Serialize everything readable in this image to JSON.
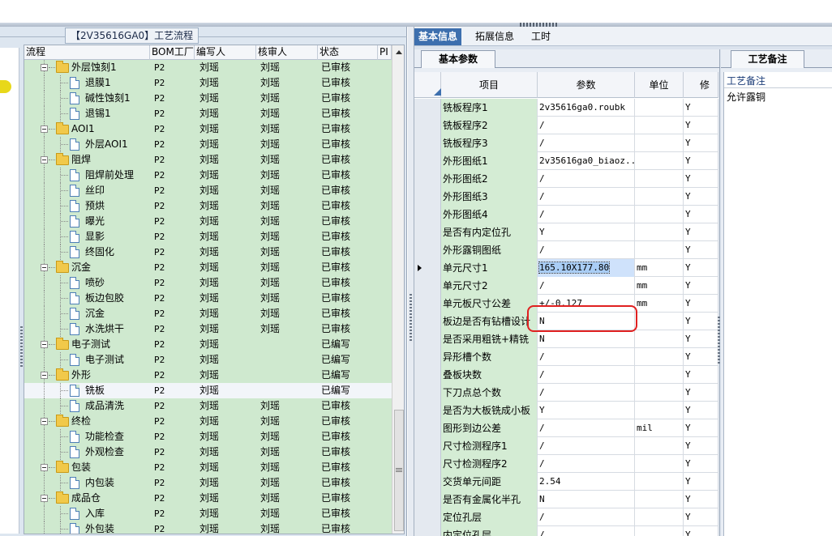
{
  "left_panel": {
    "legend": "【2V35616GA0】工艺流程",
    "columns": [
      "流程",
      "BOM工厂",
      "编写人",
      "核审人",
      "状态",
      "PI"
    ],
    "rows": [
      {
        "level": 1,
        "type": "folder",
        "name": "外层蚀刻1",
        "bom": "P2",
        "writer": "刘瑶",
        "reviewer": "刘瑶",
        "status": "已审核"
      },
      {
        "level": 2,
        "type": "doc",
        "name": "退膜1",
        "bom": "P2",
        "writer": "刘瑶",
        "reviewer": "刘瑶",
        "status": "已审核"
      },
      {
        "level": 2,
        "type": "doc",
        "name": "碱性蚀刻1",
        "bom": "P2",
        "writer": "刘瑶",
        "reviewer": "刘瑶",
        "status": "已审核"
      },
      {
        "level": 2,
        "type": "doc",
        "name": "退锡1",
        "bom": "P2",
        "writer": "刘瑶",
        "reviewer": "刘瑶",
        "status": "已审核"
      },
      {
        "level": 1,
        "type": "folder",
        "name": "AOI1",
        "bom": "P2",
        "writer": "刘瑶",
        "reviewer": "刘瑶",
        "status": "已审核"
      },
      {
        "level": 2,
        "type": "doc",
        "name": "外层AOI1",
        "bom": "P2",
        "writer": "刘瑶",
        "reviewer": "刘瑶",
        "status": "已审核"
      },
      {
        "level": 1,
        "type": "folder",
        "name": "阻焊",
        "bom": "P2",
        "writer": "刘瑶",
        "reviewer": "刘瑶",
        "status": "已审核"
      },
      {
        "level": 2,
        "type": "doc",
        "name": "阻焊前处理",
        "bom": "P2",
        "writer": "刘瑶",
        "reviewer": "刘瑶",
        "status": "已审核"
      },
      {
        "level": 2,
        "type": "doc",
        "name": "丝印",
        "bom": "P2",
        "writer": "刘瑶",
        "reviewer": "刘瑶",
        "status": "已审核"
      },
      {
        "level": 2,
        "type": "doc",
        "name": "预烘",
        "bom": "P2",
        "writer": "刘瑶",
        "reviewer": "刘瑶",
        "status": "已审核"
      },
      {
        "level": 2,
        "type": "doc",
        "name": "曝光",
        "bom": "P2",
        "writer": "刘瑶",
        "reviewer": "刘瑶",
        "status": "已审核"
      },
      {
        "level": 2,
        "type": "doc",
        "name": "显影",
        "bom": "P2",
        "writer": "刘瑶",
        "reviewer": "刘瑶",
        "status": "已审核"
      },
      {
        "level": 2,
        "type": "doc",
        "name": "终固化",
        "bom": "P2",
        "writer": "刘瑶",
        "reviewer": "刘瑶",
        "status": "已审核"
      },
      {
        "level": 1,
        "type": "folder",
        "name": "沉金",
        "bom": "P2",
        "writer": "刘瑶",
        "reviewer": "刘瑶",
        "status": "已审核"
      },
      {
        "level": 2,
        "type": "doc",
        "name": "喷砂",
        "bom": "P2",
        "writer": "刘瑶",
        "reviewer": "刘瑶",
        "status": "已审核"
      },
      {
        "level": 2,
        "type": "doc",
        "name": "板边包胶",
        "bom": "P2",
        "writer": "刘瑶",
        "reviewer": "刘瑶",
        "status": "已审核"
      },
      {
        "level": 2,
        "type": "doc",
        "name": "沉金",
        "bom": "P2",
        "writer": "刘瑶",
        "reviewer": "刘瑶",
        "status": "已审核"
      },
      {
        "level": 2,
        "type": "doc",
        "name": "水洗烘干",
        "bom": "P2",
        "writer": "刘瑶",
        "reviewer": "刘瑶",
        "status": "已审核"
      },
      {
        "level": 1,
        "type": "folder",
        "name": "电子测试",
        "bom": "P2",
        "writer": "刘瑶",
        "reviewer": "",
        "status": "已编写"
      },
      {
        "level": 2,
        "type": "doc",
        "name": "电子测试",
        "bom": "P2",
        "writer": "刘瑶",
        "reviewer": "",
        "status": "已编写"
      },
      {
        "level": 1,
        "type": "folder",
        "name": "外形",
        "bom": "P2",
        "writer": "刘瑶",
        "reviewer": "",
        "status": "已编写"
      },
      {
        "level": 2,
        "type": "doc",
        "name": "铣板",
        "bom": "P2",
        "writer": "刘瑶",
        "reviewer": "",
        "status": "已编写",
        "selected": true
      },
      {
        "level": 2,
        "type": "doc",
        "name": "成品清洗",
        "bom": "P2",
        "writer": "刘瑶",
        "reviewer": "刘瑶",
        "status": "已审核"
      },
      {
        "level": 1,
        "type": "folder",
        "name": "终检",
        "bom": "P2",
        "writer": "刘瑶",
        "reviewer": "刘瑶",
        "status": "已审核"
      },
      {
        "level": 2,
        "type": "doc",
        "name": "功能检查",
        "bom": "P2",
        "writer": "刘瑶",
        "reviewer": "刘瑶",
        "status": "已审核"
      },
      {
        "level": 2,
        "type": "doc",
        "name": "外观检查",
        "bom": "P2",
        "writer": "刘瑶",
        "reviewer": "刘瑶",
        "status": "已审核"
      },
      {
        "level": 1,
        "type": "folder",
        "name": "包装",
        "bom": "P2",
        "writer": "刘瑶",
        "reviewer": "刘瑶",
        "status": "已审核"
      },
      {
        "level": 2,
        "type": "doc",
        "name": "内包装",
        "bom": "P2",
        "writer": "刘瑶",
        "reviewer": "刘瑶",
        "status": "已审核"
      },
      {
        "level": 1,
        "type": "folder",
        "name": "成品仓",
        "bom": "P2",
        "writer": "刘瑶",
        "reviewer": "刘瑶",
        "status": "已审核"
      },
      {
        "level": 2,
        "type": "doc",
        "name": "入库",
        "bom": "P2",
        "writer": "刘瑶",
        "reviewer": "刘瑶",
        "status": "已审核"
      },
      {
        "level": 2,
        "type": "doc",
        "name": "外包装",
        "bom": "P2",
        "writer": "刘瑶",
        "reviewer": "刘瑶",
        "status": "已审核"
      }
    ]
  },
  "right_tabs": [
    "基本信息",
    "拓展信息",
    "工时"
  ],
  "sub_tab": "基本参数",
  "grid": {
    "columns": [
      "项目",
      "参数",
      "单位",
      "修改"
    ],
    "rows": [
      {
        "item": "铣板程序1",
        "param": "2v35616ga0.roubk",
        "unit": "",
        "mod": "Y"
      },
      {
        "item": "铣板程序2",
        "param": "/",
        "unit": "",
        "mod": "Y"
      },
      {
        "item": "铣板程序3",
        "param": "/",
        "unit": "",
        "mod": "Y"
      },
      {
        "item": "外形图纸1",
        "param": "2v35616ga0_biaoz...",
        "unit": "",
        "mod": "Y"
      },
      {
        "item": "外形图纸2",
        "param": "/",
        "unit": "",
        "mod": "Y"
      },
      {
        "item": "外形图纸3",
        "param": "/",
        "unit": "",
        "mod": "Y"
      },
      {
        "item": "外形图纸4",
        "param": "/",
        "unit": "",
        "mod": "Y"
      },
      {
        "item": "是否有内定位孔",
        "param": "Y",
        "unit": "",
        "mod": "Y"
      },
      {
        "item": "外形露铜图纸",
        "param": "/",
        "unit": "",
        "mod": "Y"
      },
      {
        "item": "单元尺寸1",
        "param": "165.10X177.80",
        "unit": "mm",
        "mod": "Y",
        "current": true
      },
      {
        "item": "单元尺寸2",
        "param": "/",
        "unit": "mm",
        "mod": "Y"
      },
      {
        "item": "单元板尺寸公差",
        "param": "+/-0.127",
        "unit": "mm",
        "mod": "Y"
      },
      {
        "item": "板边是否有钻槽设计",
        "param": "N",
        "unit": "",
        "mod": "Y"
      },
      {
        "item": "是否采用粗铣+精铣",
        "param": "N",
        "unit": "",
        "mod": "Y"
      },
      {
        "item": "异形槽个数",
        "param": "/",
        "unit": "",
        "mod": "Y"
      },
      {
        "item": "叠板块数",
        "param": "/",
        "unit": "",
        "mod": "Y"
      },
      {
        "item": "下刀点总个数",
        "param": "/",
        "unit": "",
        "mod": "Y"
      },
      {
        "item": "是否为大板铣成小板",
        "param": "Y",
        "unit": "",
        "mod": "Y"
      },
      {
        "item": "图形到边公差",
        "param": "/",
        "unit": "mil",
        "mod": "Y"
      },
      {
        "item": "尺寸检测程序1",
        "param": "/",
        "unit": "",
        "mod": "Y"
      },
      {
        "item": "尺寸检测程序2",
        "param": "/",
        "unit": "",
        "mod": "Y"
      },
      {
        "item": "交货单元间距",
        "param": "2.54",
        "unit": "",
        "mod": "Y"
      },
      {
        "item": "是否有金属化半孔",
        "param": "N",
        "unit": "",
        "mod": "Y"
      },
      {
        "item": "定位孔层",
        "param": "/",
        "unit": "",
        "mod": "Y"
      },
      {
        "item": "内定位孔层",
        "param": "/",
        "unit": "",
        "mod": "Y"
      }
    ]
  },
  "note_panel": {
    "tab": "工艺备注",
    "title": "工艺备注",
    "text": "允许露铜"
  },
  "colors": {
    "accent": "#3d6fae",
    "row_green": "#cfe9cf",
    "highlight": "#e02020"
  }
}
